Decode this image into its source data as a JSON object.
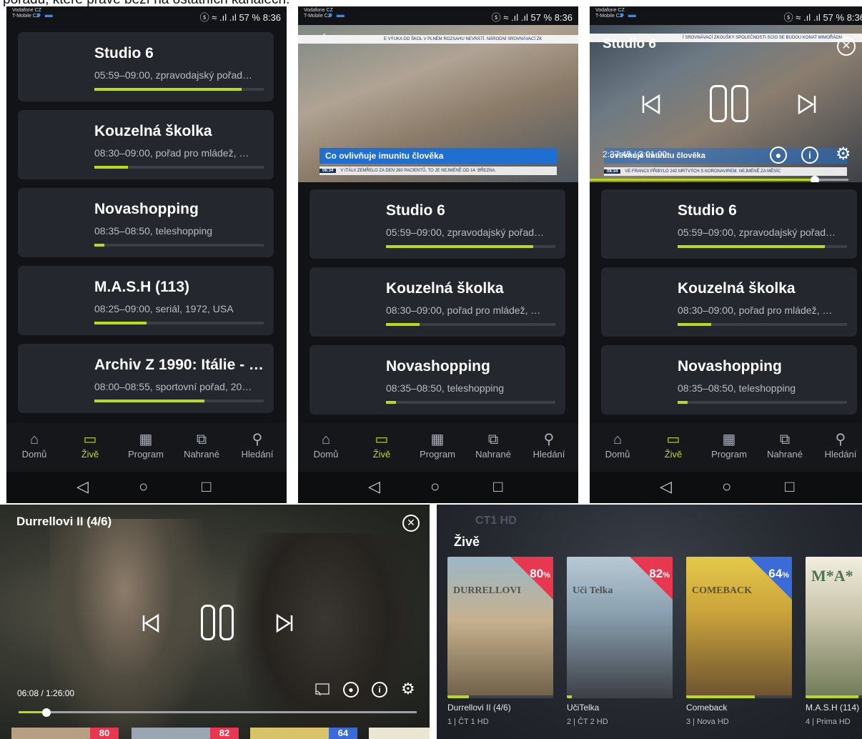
{
  "caption": "pořadu, které právě běží na ostatních kanálech.",
  "statusbar": {
    "carrier_line1": "Vodafone CZ",
    "carrier_line2": "T-Mobile CZ",
    "right": "57 %  8:36"
  },
  "nav": {
    "items": [
      {
        "label": "Domů",
        "icon": "home-icon"
      },
      {
        "label": "Živě",
        "icon": "tv-icon"
      },
      {
        "label": "Program",
        "icon": "calendar-icon"
      },
      {
        "label": "Nahrané",
        "icon": "recordings-icon"
      },
      {
        "label": "Hledání",
        "icon": "search-icon"
      }
    ],
    "active_index": 1
  },
  "android_nav": {
    "back": "◁",
    "home": "○",
    "recents": "□"
  },
  "screen1": {
    "cards": [
      {
        "title": "Studio 6",
        "sub": "05:59–09:00, zpravodajský pořad…",
        "progress": 0.87
      },
      {
        "title": "Kouzelná školka",
        "sub": "08:30–09:00, pořad pro mládež, …",
        "progress": 0.2
      },
      {
        "title": "Novashopping",
        "sub": "08:35–08:50, teleshopping",
        "progress": 0.06
      },
      {
        "title": "M.A.S.H (113)",
        "sub": "08:25–09:00, seriál, 1972, USA",
        "progress": 0.31
      },
      {
        "title": "Archiv Z 1990: Itálie - …",
        "sub": "08:00–08:55, sportovní pořad, 20…",
        "progress": 0.65
      }
    ]
  },
  "screen2": {
    "ticker_top": "E VÝUKA DO ŠKOL V PLNÉM ROZSAHU NEVRÁTÍ.   NÁRODNÍ SROVNÁVACÍ ZK",
    "headline": "Co ovlivňuje imunitu člověka",
    "ticker_time": "08:34",
    "ticker_bottom": "V ITÁLII ZEMŘELO ZA DEN 260 PACIENTŮ, TO JE NEJMÉNĚ OD 14. BŘEZNA.",
    "cards": [
      {
        "title": "Studio 6",
        "sub": "05:59–09:00, zpravodajský pořad…",
        "progress": 0.87
      },
      {
        "title": "Kouzelná školka",
        "sub": "08:30–09:00, pořad pro mládež, …",
        "progress": 0.2
      },
      {
        "title": "Novashopping",
        "sub": "08:35–08:50, teleshopping",
        "progress": 0.06
      }
    ]
  },
  "screen3": {
    "title": "Studio 6",
    "ticker_top": "Í SROVNÁVACÍ ZKOUŠKY SPOLEČNOSTI SCIO SE BUDOU KONAT MIMOŘÁDN",
    "timecode": "2:37:45 / 3:01:00",
    "headline_partial": "ovlivňuje imunitu člověka",
    "ticker_bottom": "VE FRANCII PŘIBYLO 242 MRTVÝCH S KORONAVIREM. NEJMÉNĚ ZA MĚSÍC",
    "seek_progress": 0.87,
    "cards": [
      {
        "title": "Studio 6",
        "sub": "05:59–09:00, zpravodajský pořad…",
        "progress": 0.87
      },
      {
        "title": "Kouzelná školka",
        "sub": "08:30–09:00, pořad pro mládež, …",
        "progress": 0.2
      },
      {
        "title": "Novashopping",
        "sub": "08:35–08:50, teleshopping",
        "progress": 0.06
      }
    ]
  },
  "screen4": {
    "title": "Durrellovi II (4/6)",
    "timecode": "06:08 / 1:26:00",
    "seek_progress": 0.07,
    "mini_pcts": [
      "80",
      "82",
      "64"
    ]
  },
  "screen5": {
    "brand": "CT1 HD",
    "header": "Živě",
    "posters": [
      {
        "title": "Durrellovi II (4/6)",
        "channel": "1 | ČT 1 HD",
        "pct": "80",
        "color": "#e8384f",
        "progress": 0.2
      },
      {
        "title": "UčiTelka",
        "channel": "2 | ČT 2 HD",
        "pct": "82",
        "color": "#e8384f",
        "progress": 0.05
      },
      {
        "title": "Comeback",
        "channel": "3 | Nova HD",
        "pct": "64",
        "color": "#3a6bd6",
        "progress": 0.65
      },
      {
        "title": "M.A.S.H (114)",
        "channel": "4 | Prima HD",
        "pct": "",
        "color": "#3a6bd6",
        "progress": 0.5
      }
    ],
    "poster_art": [
      "DURRELLOVI",
      "Uči Telka",
      "COMEBACK",
      "M*A*"
    ]
  },
  "colors": {
    "accent": "#b8dc1a",
    "card_bg": "#24272e",
    "screen_bg": "#121316",
    "headline_blue": "#1f6fd0"
  }
}
